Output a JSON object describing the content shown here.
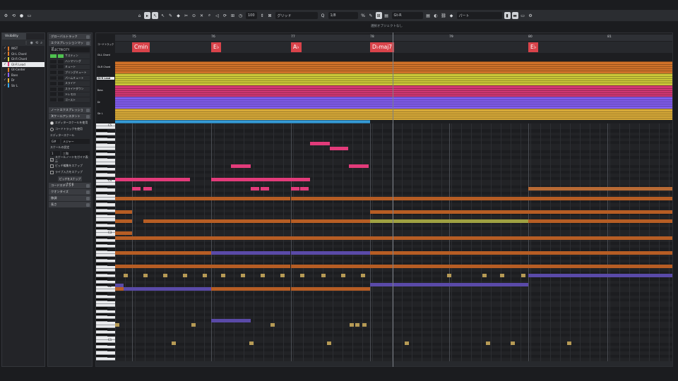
{
  "toolbar": {
    "quantize_value": "100",
    "grid_label": "グリッド",
    "grid_value": "1/8",
    "track_name": "Gt-R",
    "part_label": "パート"
  },
  "info_line": "選択オブジェクトなし",
  "visibility": {
    "tab_label": "Visibility",
    "tracks": [
      {
        "name": "INST",
        "checked": true,
        "color": "#e07a2a",
        "selected": false
      },
      {
        "name": "Gt-L Chord",
        "checked": true,
        "color": "#e07a2a",
        "selected": false
      },
      {
        "name": "Gt-R Chord",
        "checked": true,
        "color": "#d9d53b",
        "selected": false
      },
      {
        "name": "Gt-R Lead",
        "checked": true,
        "color": "#e23b7a",
        "selected": true
      },
      {
        "name": "Gt-Center",
        "checked": false,
        "color": "#e07a2a",
        "selected": false
      },
      {
        "name": "Bass",
        "checked": true,
        "color": "#8a63ff",
        "selected": false
      },
      {
        "name": "Dr",
        "checked": true,
        "color": "#e8b63b",
        "selected": false
      },
      {
        "name": "Str L",
        "checked": true,
        "color": "#39a6e6",
        "selected": false
      }
    ]
  },
  "inspector": {
    "sections": [
      {
        "label": "グローバルトラック"
      },
      {
        "label": "エクスプレッションマップ"
      }
    ],
    "expression_map": "ELECTRICITY",
    "articulations": [
      "サスティン",
      "ハンマリング",
      "ミュート",
      "プリングミュート",
      "パームミュート",
      "スライド",
      "スライドダウン",
      "トレモロ",
      "ゴースト"
    ],
    "note_expression": "ノートエクスプレッション",
    "scale_assistant": "スケールアシスタント",
    "scale_options": [
      {
        "label": "エディタースケールを使用",
        "on": true
      },
      {
        "label": "コードトラックを使用",
        "on": false
      }
    ],
    "editor_scale_label": "エディタースケール",
    "editor_scale_key": "G#",
    "editor_scale_type": "メジャー",
    "scale_setting_label": "スケールの設定",
    "scale_setting_value": "1",
    "scale_setting_type": "三和",
    "checks": [
      {
        "label": "スケールノートをガイド表示",
        "on": true
      },
      {
        "label": "ピッチ編集をスナップ",
        "on": false
      },
      {
        "label": "ライブ入力をスナップ",
        "on": false
      }
    ],
    "pitch_button": "ピッチをスナップさせる",
    "more_sections": [
      {
        "label": "コードエディット"
      },
      {
        "label": "クオンタイズ"
      },
      {
        "label": "移調"
      },
      {
        "label": "長さ"
      }
    ]
  },
  "ruler": {
    "bars": [
      "75",
      "76",
      "77",
      "78",
      "79",
      "80",
      "81"
    ]
  },
  "chords": [
    "Cmin",
    "E♭",
    "A♭",
    "D♭maj7",
    "E♭"
  ],
  "lanes": [
    {
      "label": "コードトラック",
      "selected": false
    },
    {
      "label": "Gt-L Chord",
      "selected": false
    },
    {
      "label": "Gt-R Chord",
      "selected": false
    },
    {
      "label": "Gt-R Lead",
      "selected": true
    },
    {
      "label": "Bass",
      "selected": false
    },
    {
      "label": "Dr",
      "selected": false
    },
    {
      "label": "Str L",
      "selected": false
    }
  ],
  "octave_labels": [
    "C5",
    "C4",
    "C3",
    "C2",
    "C1"
  ],
  "notes": {
    "lead": [
      "D#5",
      "C#5",
      "G#4",
      "G#4",
      "C4",
      "C4",
      "C4",
      "C4",
      "C4",
      "C4",
      "A#3",
      "A#3",
      "A#3",
      "A#3",
      "A#3",
      "A#3",
      "D#4"
    ]
  }
}
